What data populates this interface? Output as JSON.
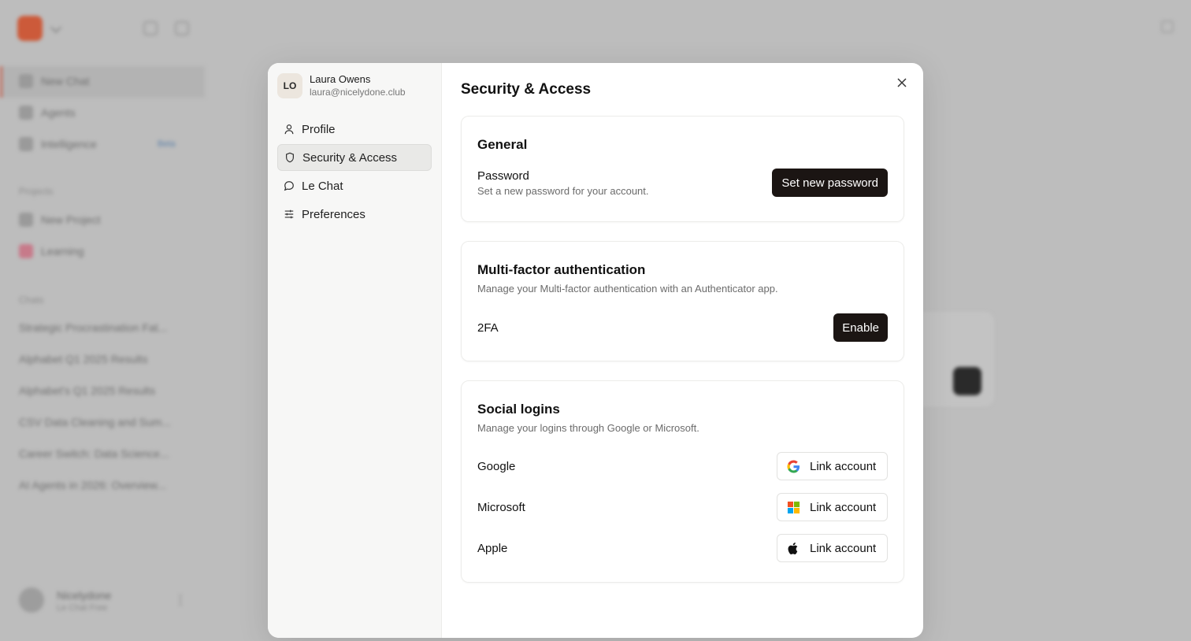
{
  "background": {
    "sidebar": {
      "nav_items": [
        {
          "label": "New Chat",
          "icon": "chat-plus-icon"
        },
        {
          "label": "Agents",
          "icon": "robot-icon"
        },
        {
          "label": "Intelligence",
          "icon": "sparkle-icon",
          "badge": "Beta"
        }
      ],
      "projects_header": "Projects",
      "projects": [
        {
          "label": "New Project",
          "icon": "folder-plus-icon"
        },
        {
          "label": "Learning",
          "icon": "heart-icon"
        }
      ],
      "chats_header": "Chats",
      "chats": [
        "Strategic Procrastination Fat...",
        "Alphabet Q1 2025 Results",
        "Alphabet's Q1 2025 Results",
        "CSV Data Cleaning and Sum...",
        "Career Switch: Data Science...",
        "AI Agents in 2026: Overview..."
      ],
      "user": {
        "name": "Nicelydone",
        "plan": "Le Chat Free"
      }
    }
  },
  "modal": {
    "user": {
      "initials": "LO",
      "name": "Laura Owens",
      "email": "laura@nicelydone.club"
    },
    "menu": [
      {
        "label": "Profile",
        "icon": "user-icon",
        "active": false
      },
      {
        "label": "Security & Access",
        "icon": "shield-icon",
        "active": true
      },
      {
        "label": "Le Chat",
        "icon": "chat-bubble-icon",
        "active": false
      },
      {
        "label": "Preferences",
        "icon": "sliders-icon",
        "active": false
      }
    ],
    "title": "Security & Access",
    "general": {
      "title": "General",
      "password_label": "Password",
      "password_desc": "Set a new password for your account.",
      "password_button": "Set new password"
    },
    "mfa": {
      "title": "Multi-factor authentication",
      "desc": "Manage your Multi-factor authentication with an Authenticator app.",
      "label": "2FA",
      "button": "Enable"
    },
    "social": {
      "title": "Social logins",
      "desc": "Manage your logins through Google or Microsoft.",
      "providers": [
        {
          "name": "Google",
          "icon": "google-icon",
          "button": "Link account"
        },
        {
          "name": "Microsoft",
          "icon": "microsoft-icon",
          "button": "Link account"
        },
        {
          "name": "Apple",
          "icon": "apple-icon",
          "button": "Link account"
        }
      ]
    }
  }
}
